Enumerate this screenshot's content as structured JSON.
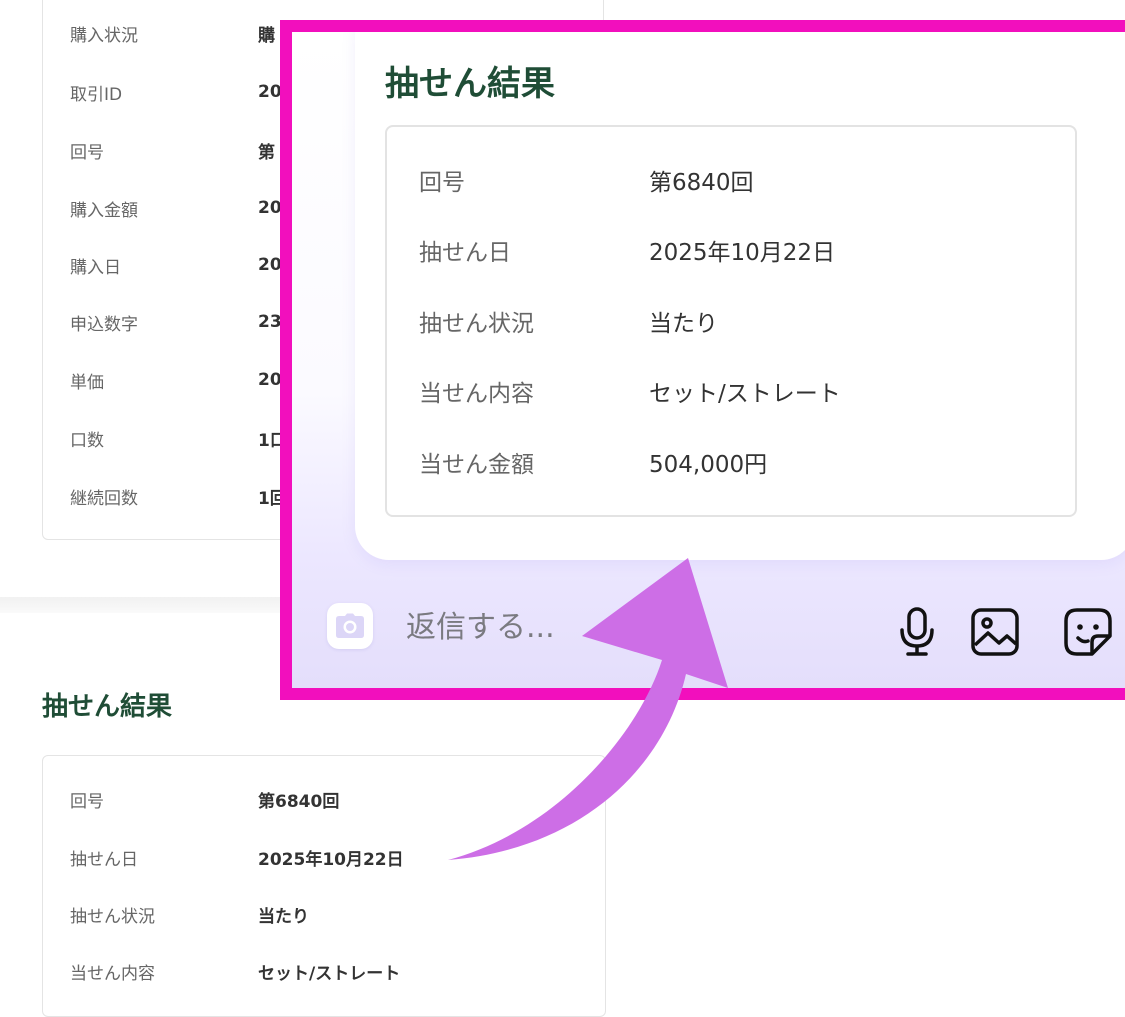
{
  "background": {
    "purchase_rows": [
      {
        "key": "購入状況",
        "value": "購"
      },
      {
        "key": "取引ID",
        "value": "20"
      },
      {
        "key": "回号",
        "value": "第"
      },
      {
        "key": "購入金額",
        "value": "20"
      },
      {
        "key": "購入日",
        "value": "20"
      },
      {
        "key": "申込数字",
        "value": "23"
      },
      {
        "key": "単価",
        "value": "20"
      },
      {
        "key": "口数",
        "value": "1口"
      },
      {
        "key": "継続回数",
        "value": "1回"
      }
    ],
    "section_title": "抽せん結果",
    "result_rows": [
      {
        "key": "回号",
        "value": "第6840回"
      },
      {
        "key": "抽せん日",
        "value": "2025年10月22日"
      },
      {
        "key": "抽せん状況",
        "value": "当たり"
      },
      {
        "key": "当せん内容",
        "value": "セット/ストレート"
      }
    ]
  },
  "zoom": {
    "title": "抽せん結果",
    "rows": [
      {
        "key": "回号",
        "value": "第6840回"
      },
      {
        "key": "抽せん日",
        "value": "2025年10月22日"
      },
      {
        "key": "抽せん状況",
        "value": "当たり"
      },
      {
        "key": "当せん内容",
        "value": "セット/ストレート"
      },
      {
        "key": "当せん金額",
        "value": "504,000円"
      }
    ],
    "reply_bar": {
      "placeholder": "返信する...",
      "icons": [
        "camera-icon",
        "microphone-icon",
        "image-icon",
        "sticker-icon"
      ]
    }
  },
  "colors": {
    "highlight_frame": "#f20fbd",
    "arrow": "#cd6ee6",
    "heading_green": "#1f4d36"
  }
}
